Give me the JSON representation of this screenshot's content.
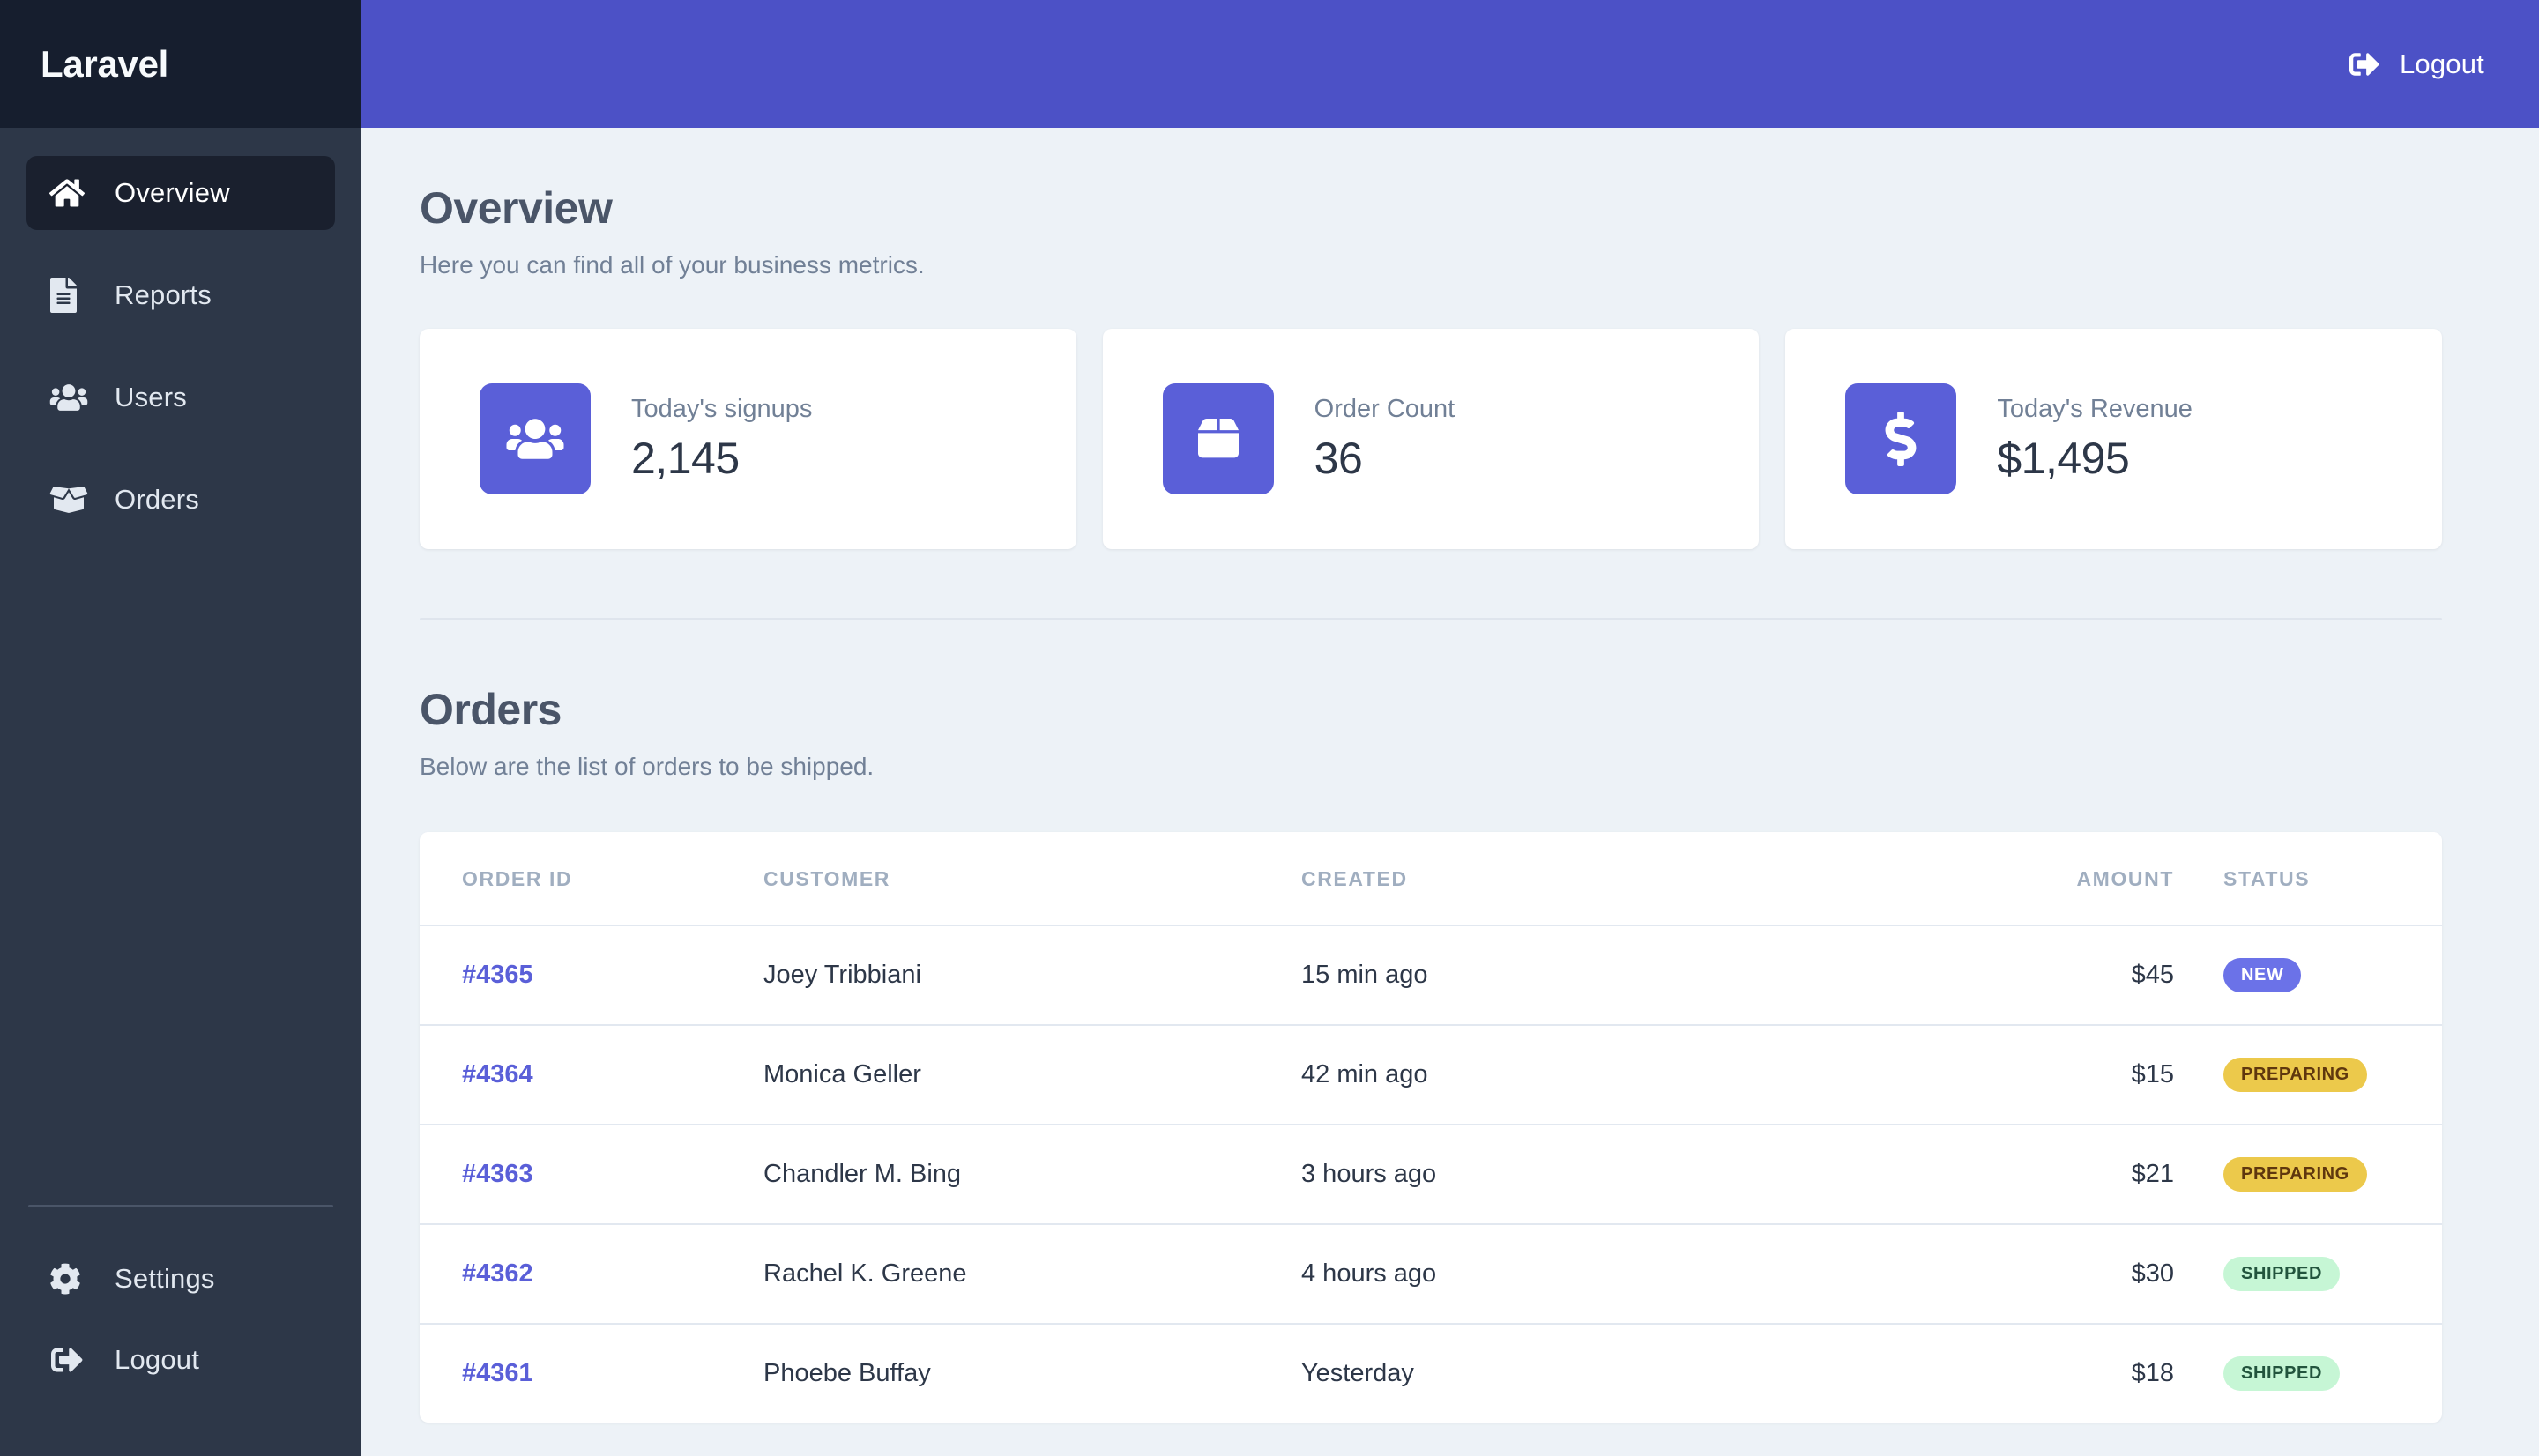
{
  "brand": {
    "name": "Laravel"
  },
  "sidebar": {
    "items": [
      {
        "label": "Overview",
        "icon": "home-icon",
        "active": true
      },
      {
        "label": "Reports",
        "icon": "document-icon",
        "active": false
      },
      {
        "label": "Users",
        "icon": "users-icon",
        "active": false
      },
      {
        "label": "Orders",
        "icon": "box-open-icon",
        "active": false
      }
    ],
    "bottom_items": [
      {
        "label": "Settings",
        "icon": "gear-icon"
      },
      {
        "label": "Logout",
        "icon": "sign-out-icon"
      }
    ]
  },
  "topbar": {
    "logout_label": "Logout",
    "logout_icon": "sign-out-icon",
    "background": "#4c51c6"
  },
  "overview": {
    "title": "Overview",
    "subtitle": "Here you can find all of your business metrics.",
    "stats": [
      {
        "label": "Today's signups",
        "value": "2,145",
        "icon": "users-icon"
      },
      {
        "label": "Order Count",
        "value": "36",
        "icon": "box-icon"
      },
      {
        "label": "Today's Revenue",
        "value": "$1,495",
        "icon": "dollar-icon"
      }
    ]
  },
  "orders": {
    "title": "Orders",
    "subtitle": "Below are the list of orders to be shipped.",
    "columns": [
      "ORDER ID",
      "CUSTOMER",
      "CREATED",
      "AMOUNT",
      "STATUS"
    ],
    "rows": [
      {
        "id": "#4365",
        "customer": "Joey Tribbiani",
        "created": "15 min ago",
        "amount": "$45",
        "status": "NEW",
        "status_kind": "new"
      },
      {
        "id": "#4364",
        "customer": "Monica Geller",
        "created": "42 min ago",
        "amount": "$15",
        "status": "PREPARING",
        "status_kind": "preparing"
      },
      {
        "id": "#4363",
        "customer": "Chandler M. Bing",
        "created": "3 hours ago",
        "amount": "$21",
        "status": "PREPARING",
        "status_kind": "preparing"
      },
      {
        "id": "#4362",
        "customer": "Rachel K. Greene",
        "created": "4 hours ago",
        "amount": "$30",
        "status": "SHIPPED",
        "status_kind": "shipped"
      },
      {
        "id": "#4361",
        "customer": "Phoebe Buffay",
        "created": "Yesterday",
        "amount": "$18",
        "status": "SHIPPED",
        "status_kind": "shipped"
      }
    ]
  },
  "colors": {
    "accent": "#5a5fd8",
    "header": "#4c51c6",
    "sidebar": "#2d3748",
    "sidebar_brand": "#161e2e",
    "content_bg": "#edf2f7",
    "badge_new": "#6b72e8",
    "badge_preparing": "#ecc94b",
    "badge_shipped": "#c6f6d5"
  }
}
